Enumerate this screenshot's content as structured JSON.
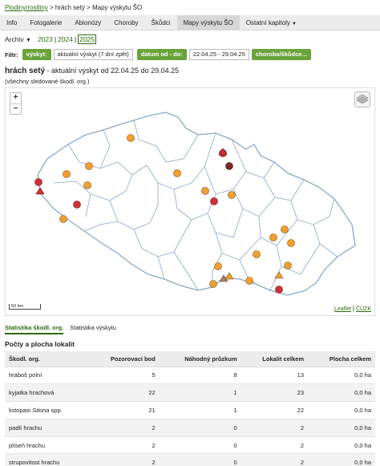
{
  "breadcrumb": {
    "link": "Plodiny/rostliny",
    "rest": " > hrách setý > Mapy výskytu ŠO"
  },
  "tabs": [
    {
      "label": "Info",
      "active": false
    },
    {
      "label": "Fotogalerie",
      "active": false
    },
    {
      "label": "Abionózy",
      "active": false
    },
    {
      "label": "Choroby",
      "active": false
    },
    {
      "label": "Škůdci",
      "active": false
    },
    {
      "label": "Mapy výskytu ŠO",
      "active": true
    },
    {
      "label": "Ostatní kapitoly",
      "active": false
    }
  ],
  "years": {
    "archiv": "Archiv",
    "y1": "2023",
    "y2": "2024",
    "y3": "2025"
  },
  "filter": {
    "label": "Filtr:",
    "vyskyt_label": "výskyt:",
    "vyskyt_value": "aktuální výskyt (7 dní zpět)",
    "datum_label": "datum od - do:",
    "datum_value": "22.04.25 - 29.04.25",
    "choroba_label": "choroba/škůdce..."
  },
  "heading": {
    "crop": "hrách setý",
    "rest": " - aktuální výskyt od 22.04.25 do 29.04.25",
    "note": "(všechny sledované škodl. org.)"
  },
  "map": {
    "zoom_in": "+",
    "zoom_out": "−",
    "scale": "50 km",
    "attrib_leaflet": "Leaflet",
    "attrib_sep": " | ",
    "attrib_cuzk": "ČÚZK"
  },
  "subtabs": {
    "a": "Statistika škodl. org.",
    "b": "Statistika výskytu"
  },
  "section_title": "Počty a plocha lokalit",
  "table": {
    "headers": [
      "Škodl. org.",
      "Pozorovací bod",
      "Náhodný průzkum",
      "Lokalit celkem",
      "Plocha celkem"
    ],
    "rows": [
      [
        "hraboš polní",
        "5",
        "8",
        "13",
        "0,0 ha"
      ],
      [
        "kyjatka hrachová",
        "22",
        "1",
        "23",
        "0,0 ha"
      ],
      [
        "listopasi Sitona spp.",
        "21",
        "1",
        "22",
        "0,0 ha"
      ],
      [
        "padlí hrachu",
        "2",
        "0",
        "2",
        "0,0 ha"
      ],
      [
        "plíseň hrachu",
        "2",
        "0",
        "2",
        "0,0 ha"
      ],
      [
        "strupovitost hrachu",
        "2",
        "0",
        "2",
        "0,0 ha"
      ]
    ]
  },
  "colors": {
    "accent": "#6aa33a",
    "link": "#2e6b12",
    "orange": "#f0a030",
    "red": "#d0303a",
    "dark": "#7a2a20",
    "region": "#8aa8c8"
  }
}
